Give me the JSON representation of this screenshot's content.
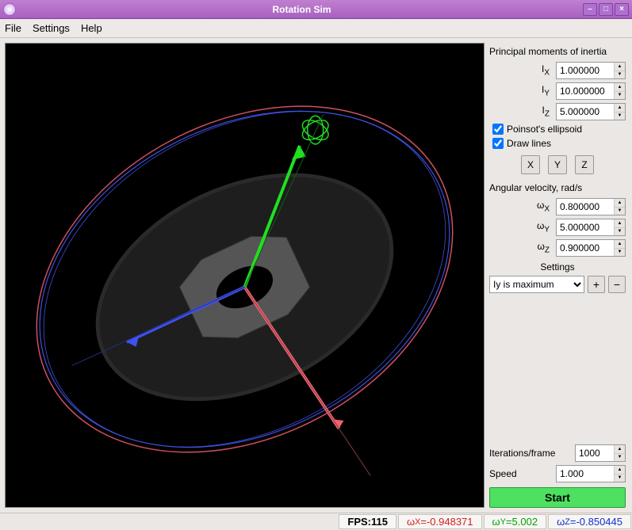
{
  "window": {
    "title": "Rotation Sim"
  },
  "menu": {
    "file": "File",
    "settings": "Settings",
    "help": "Help"
  },
  "inertia": {
    "title": "Principal moments of inertia",
    "ix_label": "Iₓ",
    "ix": "1.000000",
    "iy_label": "Iᵧ",
    "iy": "10.000000",
    "iz_label": "I_Z",
    "iz": "5.000000"
  },
  "checks": {
    "poinsot": "Poinsot's ellipsoid",
    "poinsot_checked": true,
    "drawlines": "Draw lines",
    "drawlines_checked": true
  },
  "axisbtns": {
    "x": "X",
    "y": "Y",
    "z": "Z"
  },
  "angular": {
    "title": "Angular velocity, rad/s",
    "wx_label": "ωₓ",
    "wx": "0.800000",
    "wy_label": "ωᵧ",
    "wy": "5.000000",
    "wz_label": "ω_Z",
    "wz": "0.900000"
  },
  "settings": {
    "title": "Settings",
    "preset": "Iy is maximum",
    "plus": "+",
    "minus": "−"
  },
  "iterations": {
    "label": "Iterations/frame",
    "value": "1000"
  },
  "speed": {
    "label": "Speed",
    "value": "1.000"
  },
  "start": "Start",
  "status": {
    "fps_label": "FPS: ",
    "fps": "115",
    "wx_label": "ωₓ = ",
    "wx": "-0.948371",
    "wy_label": "ωᵧ = ",
    "wy": "5.002",
    "wz_label": "ω_Z = ",
    "wz": "-0.850445"
  }
}
